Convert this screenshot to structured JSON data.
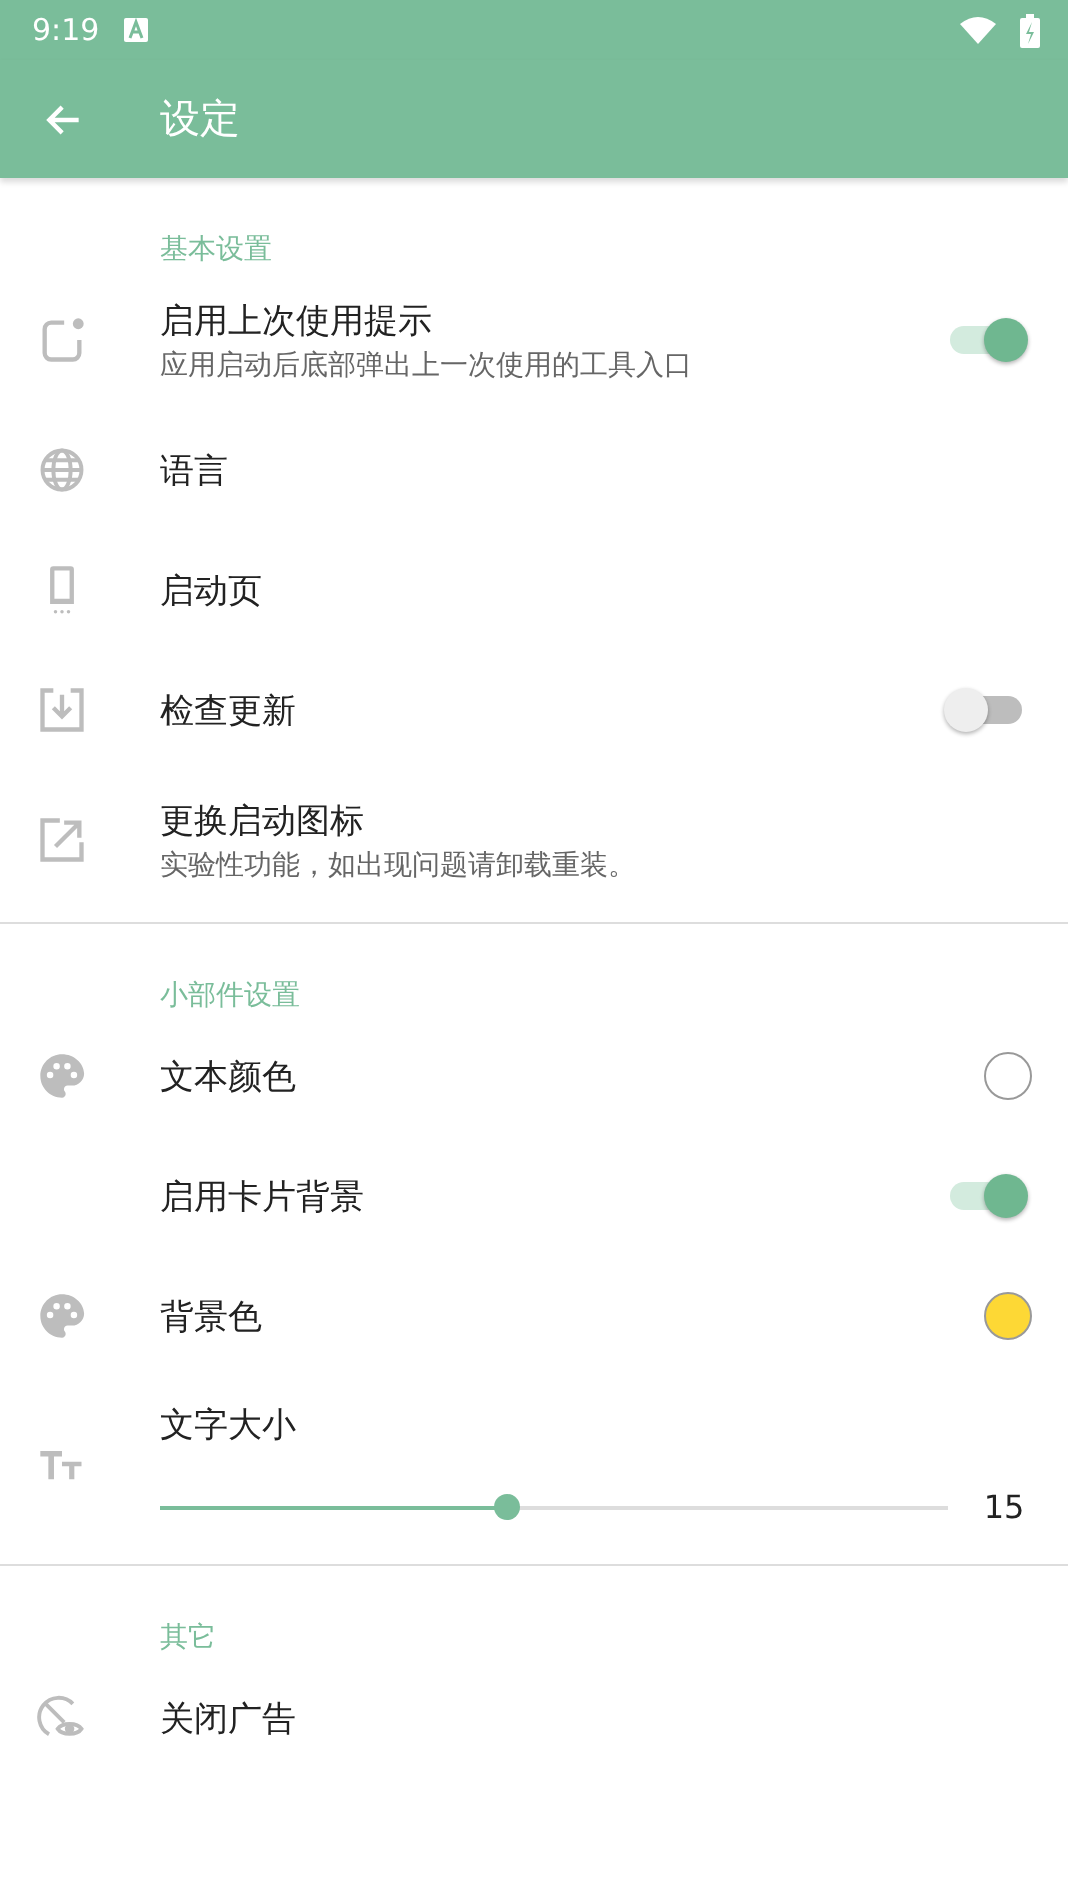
{
  "status_bar": {
    "time": "9:19"
  },
  "app_bar": {
    "title": "设定"
  },
  "sections": [
    {
      "header": "基本设置",
      "items": [
        {
          "kind": "switch",
          "title": "启用上次使用提示",
          "subtitle": "应用启动后底部弹出上一次使用的工具入口",
          "on": true
        },
        {
          "kind": "plain",
          "title": "语言"
        },
        {
          "kind": "plain",
          "title": "启动页"
        },
        {
          "kind": "switch",
          "title": "检查更新",
          "on": false
        },
        {
          "kind": "plain",
          "title": "更换启动图标",
          "subtitle": "实验性功能，如出现问题请卸载重装。"
        }
      ]
    },
    {
      "header": "小部件设置",
      "items": [
        {
          "kind": "color",
          "title": "文本颜色",
          "color": "#ffffff"
        },
        {
          "kind": "switch",
          "title": "启用卡片背景",
          "on": true
        },
        {
          "kind": "color",
          "title": "背景色",
          "color": "#fdd835"
        },
        {
          "kind": "slider",
          "title": "文字大小",
          "level": 0.44,
          "reading": "15"
        }
      ]
    },
    {
      "header": "其它",
      "items": [
        {
          "kind": "plain",
          "title": "关闭广告"
        }
      ]
    }
  ]
}
